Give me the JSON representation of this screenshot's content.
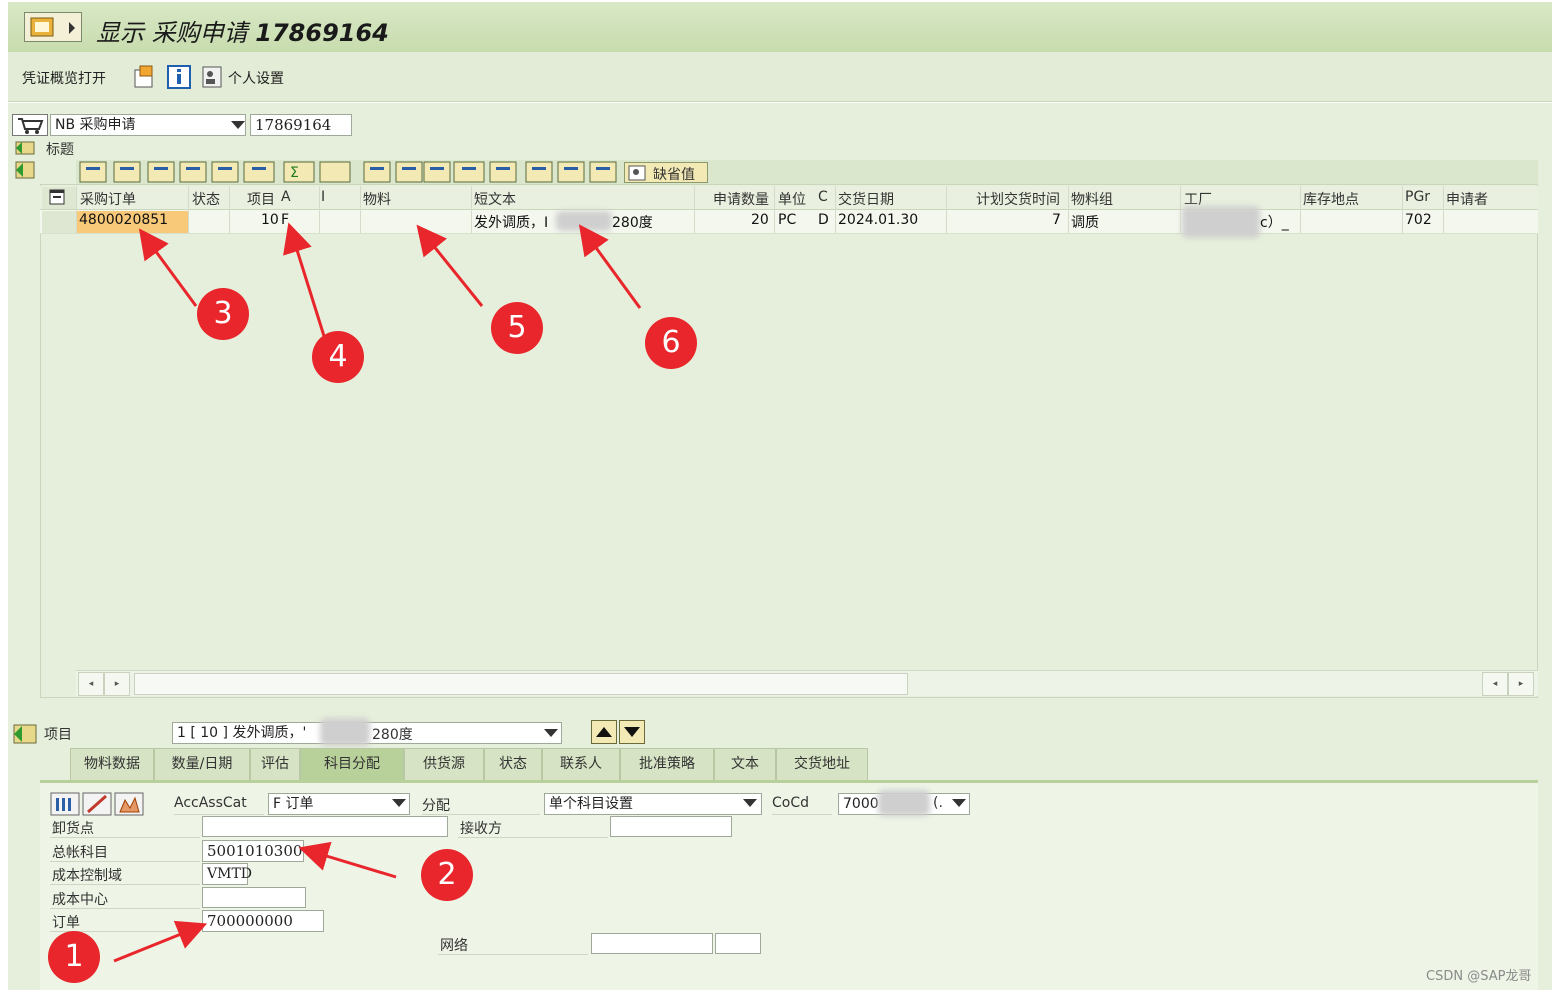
{
  "window": {
    "title_prefix": "显示 采购申请",
    "title_number": "17869164"
  },
  "toolbar": {
    "doc_overview": "凭证概览打开",
    "personal_settings": "个人设置"
  },
  "header": {
    "doc_type": "NB 采购申请",
    "doc_number": "17869164",
    "header_label": "标题",
    "default_values": "缺省值"
  },
  "grid": {
    "columns": [
      "采购订单",
      "状态",
      "项目",
      "A",
      "I",
      "物料",
      "短文本",
      "申请数量",
      "单位",
      "C",
      "交货日期",
      "计划交货时间",
      "物料组",
      "工厂",
      "库存地点",
      "PGr",
      "申请者"
    ],
    "row": {
      "po": "4800020851",
      "item": "10",
      "acct": "F",
      "short_text_a": "发外调质，I",
      "short_text_b": "280度",
      "qty": "20",
      "unit": "PC",
      "cat": "D",
      "date": "2024.01.30",
      "plan_time": "7",
      "mat_group": "调质",
      "plant": "c）_",
      "pgr": "702"
    }
  },
  "item_selector": {
    "label": "项目",
    "value_a": "1 [ 10 ] 发外调质，'",
    "value_b": "280度"
  },
  "tabs": [
    "物料数据",
    "数量/日期",
    "评估",
    "科目分配",
    "供货源",
    "状态",
    "联系人",
    "批准策略",
    "文本",
    "交货地址"
  ],
  "active_tab_index": 3,
  "account": {
    "acc_ass_cat_label": "AccAssCat",
    "acc_ass_cat_value": "F 订单",
    "distribution_label": "分配",
    "distribution_value": "单个科目设置",
    "cocd_label": "CoCd",
    "cocd_value": "7000",
    "cocd_suffix": "(.",
    "unloading_point_label": "卸货点",
    "recipient_label": "接收方",
    "gl_account_label": "总帐科目",
    "gl_account_value": "5001010300",
    "controlling_area_label": "成本控制域",
    "controlling_area_value": "VMTD",
    "cost_center_label": "成本中心",
    "order_label": "订单",
    "order_value": "700000000",
    "network_label": "网络"
  },
  "annotations": [
    "1",
    "2",
    "3",
    "4",
    "5",
    "6"
  ],
  "watermark": "CSDN @SAP龙哥",
  "colors": {
    "title_bg": "#c7dcae",
    "workspace_bg": "#e6efdb",
    "highlight_cell": "#f7c978",
    "annotation_red": "#e8262c"
  }
}
